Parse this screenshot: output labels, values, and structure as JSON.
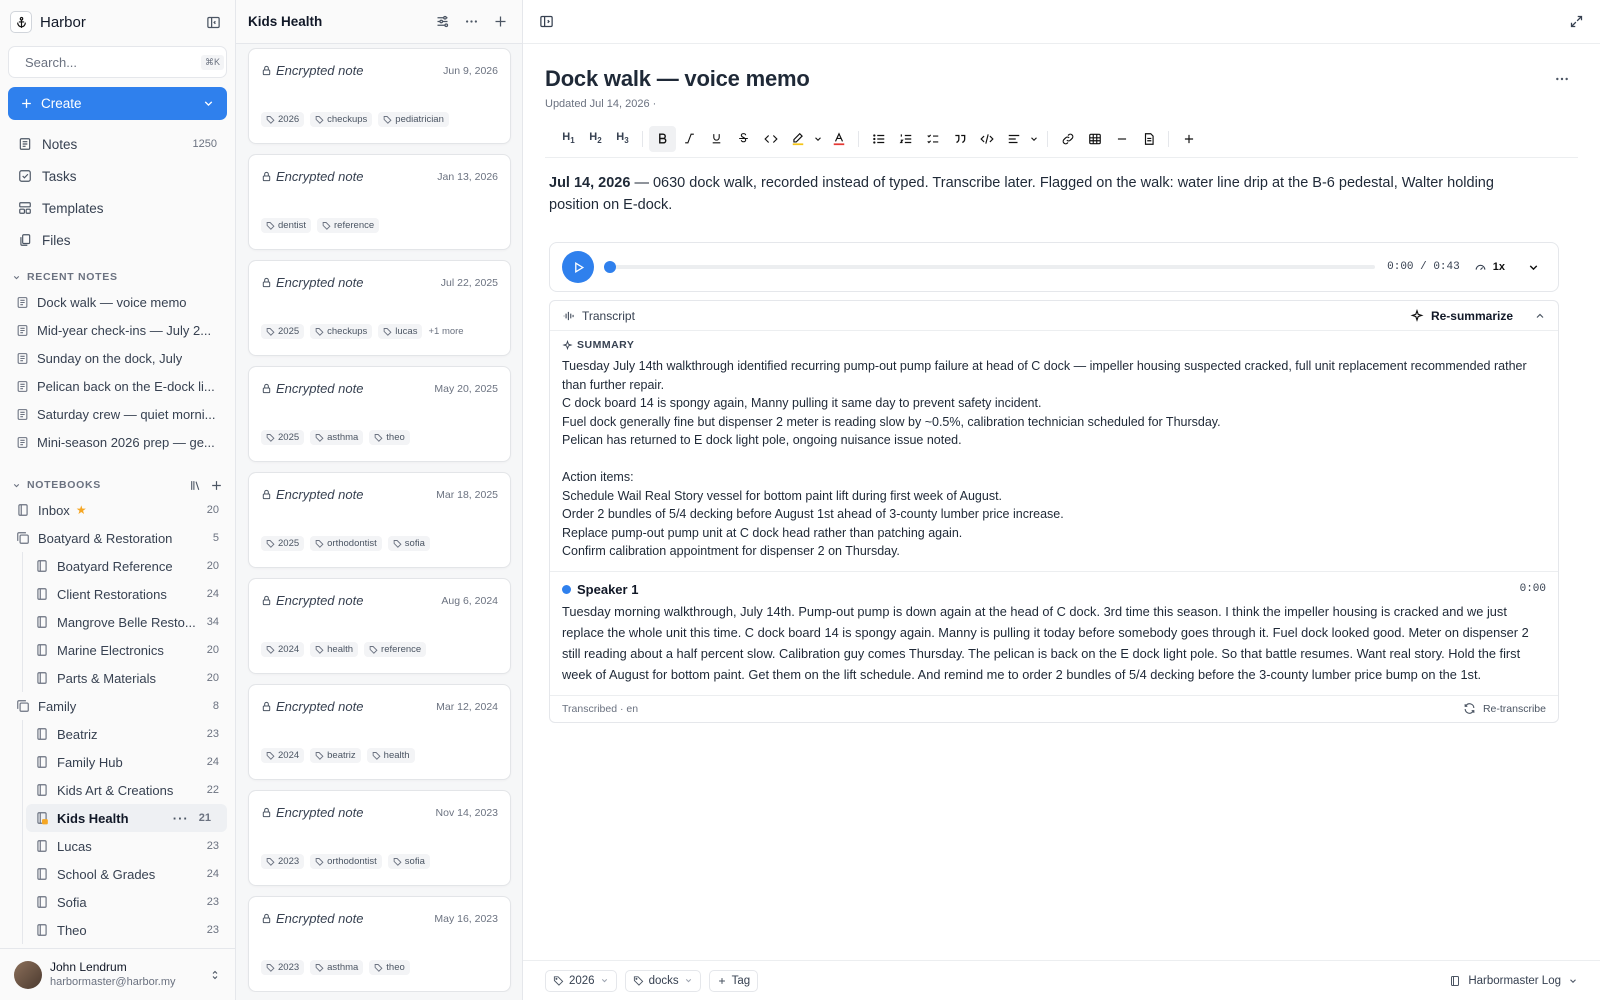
{
  "app": {
    "name": "Harbor"
  },
  "search": {
    "placeholder": "Search...",
    "shortcut": "⌘K"
  },
  "create": {
    "label": "Create"
  },
  "nav": [
    {
      "label": "Notes",
      "count": "1250",
      "icon": "notes-icon"
    },
    {
      "label": "Tasks",
      "count": "",
      "icon": "tasks-icon"
    },
    {
      "label": "Templates",
      "count": "",
      "icon": "templates-icon"
    },
    {
      "label": "Files",
      "count": "",
      "icon": "files-icon"
    }
  ],
  "recent": {
    "heading": "RECENT NOTES",
    "items": [
      "Dock walk — voice memo",
      "Mid-year check-ins — July 2...",
      "Sunday on the dock, July",
      "Pelican back on the E-dock li...",
      "Saturday crew — quiet morni...",
      "Mini-season 2026 prep — ge..."
    ]
  },
  "notebooks": {
    "heading": "NOTEBOOKS",
    "items": [
      {
        "label": "Inbox",
        "count": "20",
        "level": 0,
        "star": true
      },
      {
        "label": "Boatyard & Restoration",
        "count": "5",
        "level": 0,
        "group": true
      },
      {
        "label": "Boatyard Reference",
        "count": "20",
        "level": 1
      },
      {
        "label": "Client Restorations",
        "count": "24",
        "level": 1
      },
      {
        "label": "Mangrove Belle Resto...",
        "count": "34",
        "level": 1
      },
      {
        "label": "Marine Electronics",
        "count": "20",
        "level": 1
      },
      {
        "label": "Parts & Materials",
        "count": "20",
        "level": 1
      },
      {
        "label": "Family",
        "count": "8",
        "level": 0,
        "group": true
      },
      {
        "label": "Beatriz",
        "count": "23",
        "level": 1
      },
      {
        "label": "Family Hub",
        "count": "24",
        "level": 1
      },
      {
        "label": "Kids Art & Creations",
        "count": "22",
        "level": 1
      },
      {
        "label": "Kids Health",
        "count": "21",
        "level": 1,
        "active": true
      },
      {
        "label": "Lucas",
        "count": "23",
        "level": 1
      },
      {
        "label": "School & Grades",
        "count": "24",
        "level": 1
      },
      {
        "label": "Sofia",
        "count": "23",
        "level": 1
      },
      {
        "label": "Theo",
        "count": "23",
        "level": 1
      }
    ]
  },
  "user": {
    "name": "John Lendrum",
    "email": "harbormaster@harbor.my"
  },
  "list": {
    "title": "Kids Health",
    "cards": [
      {
        "title": "Encrypted note",
        "date": "Jun 9, 2026",
        "tags": [
          "2026",
          "checkups",
          "pediatrician"
        ],
        "more": ""
      },
      {
        "title": "Encrypted note",
        "date": "Jan 13, 2026",
        "tags": [
          "dentist",
          "reference"
        ],
        "more": ""
      },
      {
        "title": "Encrypted note",
        "date": "Jul 22, 2025",
        "tags": [
          "2025",
          "checkups",
          "lucas"
        ],
        "more": "+1 more"
      },
      {
        "title": "Encrypted note",
        "date": "May 20, 2025",
        "tags": [
          "2025",
          "asthma",
          "theo"
        ],
        "more": ""
      },
      {
        "title": "Encrypted note",
        "date": "Mar 18, 2025",
        "tags": [
          "2025",
          "orthodontist",
          "sofia"
        ],
        "more": ""
      },
      {
        "title": "Encrypted note",
        "date": "Aug 6, 2024",
        "tags": [
          "2024",
          "health",
          "reference"
        ],
        "more": ""
      },
      {
        "title": "Encrypted note",
        "date": "Mar 12, 2024",
        "tags": [
          "2024",
          "beatriz",
          "health"
        ],
        "more": ""
      },
      {
        "title": "Encrypted note",
        "date": "Nov 14, 2023",
        "tags": [
          "2023",
          "orthodontist",
          "sofia"
        ],
        "more": ""
      },
      {
        "title": "Encrypted note",
        "date": "May 16, 2023",
        "tags": [
          "2023",
          "asthma",
          "theo"
        ],
        "more": ""
      }
    ]
  },
  "doc": {
    "title": "Dock walk — voice memo",
    "updated": "Updated Jul 14, 2026  ·",
    "body_date": "Jul 14, 2026",
    "body_text": " — 0630 dock walk, recorded instead of typed. Transcribe later. Flagged on the walk: water line drip at the B-6 pedestal, Walter holding position on E-dock."
  },
  "player": {
    "time": "0:00 / 0:43",
    "speed": "1x",
    "progress": 0
  },
  "transcript": {
    "label": "Transcript",
    "resummarize": "Re-summarize",
    "summary_heading": "SUMMARY",
    "summary": "Tuesday July 14th walkthrough identified recurring pump-out pump failure at head of C dock — impeller housing suspected cracked, full unit replacement recommended rather than further repair.\nC dock board 14 is spongy again, Manny pulling it same day to prevent safety incident.\nFuel dock generally fine but dispenser 2 meter is reading slow by ~0.5%, calibration technician scheduled for Thursday.\nPelican has returned to E dock light pole, ongoing nuisance issue noted.\n\nAction items:\nSchedule Wail Real Story vessel for bottom paint lift during first week of August.\nOrder 2 bundles of 5/4 decking before August 1st ahead of 3-county lumber price increase.\nReplace pump-out pump unit at C dock head rather than patching again.\nConfirm calibration appointment for dispenser 2 on Thursday.",
    "speaker": "Speaker 1",
    "speaker_time": "0:00",
    "speaker_text": "Tuesday morning walkthrough, July 14th. Pump-out pump is down again at the head of C dock. 3rd time this season. I think the impeller housing is cracked and we just replace the whole unit this time. C dock board 14 is spongy again. Manny is pulling it today before somebody goes through it. Fuel dock looked good. Meter on dispenser 2 still reading about a half percent slow. Calibration guy comes Thursday. The pelican is back on the E dock light pole. So that battle resumes. Want real story. Hold the first week of August for bottom paint. Get them on the lift schedule. And remind me to order 2 bundles of 5/4 decking before the 3-county lumber price bump on the 1st.",
    "footer": "Transcribed · en",
    "retranscribe": "Re-transcribe"
  },
  "footer": {
    "tags": [
      "2026",
      "docks"
    ],
    "add_tag": "Tag",
    "notebook": "Harbormaster Log"
  },
  "colors": {
    "accent": "#2f80ed",
    "star": "#f5a623"
  }
}
